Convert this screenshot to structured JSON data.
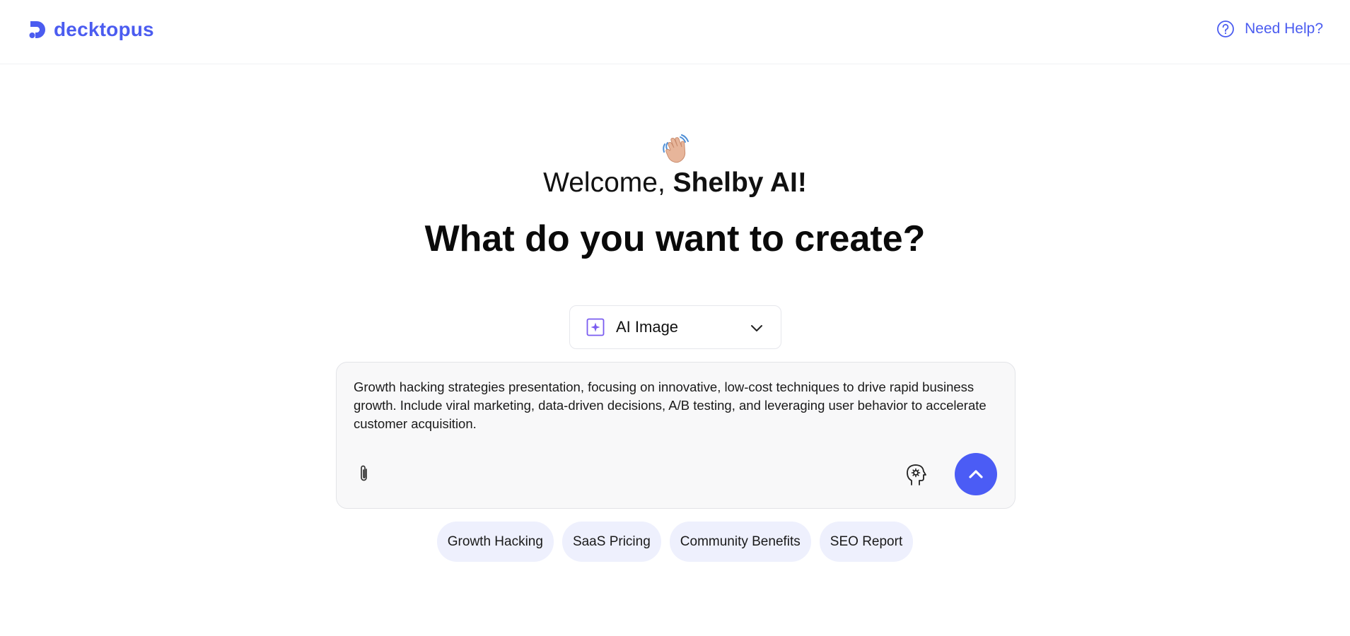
{
  "brand": {
    "name": "decktopus",
    "color": "#4b5cf0"
  },
  "header": {
    "help_label": "Need Help?",
    "help_icon": "question-circle-icon"
  },
  "greeting": {
    "emoji": "👋🏼",
    "prefix": "Welcome, ",
    "user_name": "Shelby AI!"
  },
  "headline": "What do you want to create?",
  "type_select": {
    "icon": "sparkle-icon",
    "selected": "AI Image"
  },
  "prompt": {
    "text": "Growth hacking strategies presentation, focusing on innovative, low-cost techniques to drive rapid business growth. Include viral marketing, data-driven decisions, A/B testing, and leveraging user behavior to accelerate customer acquisition.",
    "attach_icon": "paperclip-icon",
    "brain_icon": "brain-gear-icon",
    "send_icon": "chevron-up-icon",
    "send_color": "#4b5cf5"
  },
  "suggestions": [
    {
      "label": "Growth Hacking"
    },
    {
      "label": "SaaS Pricing"
    },
    {
      "label": "Community Benefits"
    },
    {
      "label": "SEO Report"
    }
  ]
}
